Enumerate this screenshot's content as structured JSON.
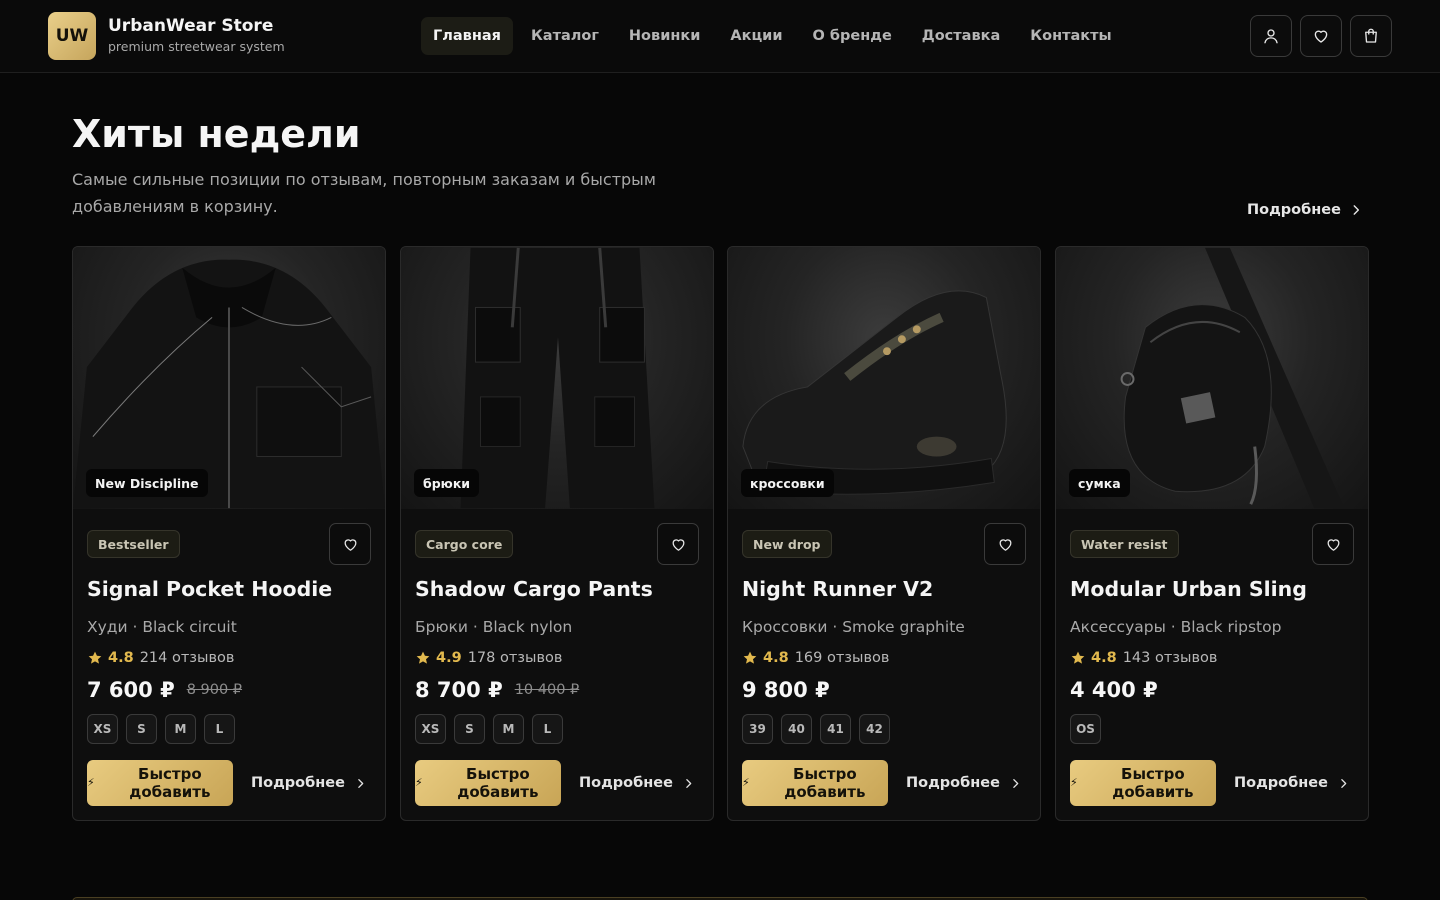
{
  "header": {
    "logo": "UW",
    "brand_name": "UrbanWear Store",
    "brand_sub": "premium streetwear system",
    "nav": [
      "Главная",
      "Каталог",
      "Новинки",
      "Акции",
      "О бренде",
      "Доставка",
      "Контакты"
    ],
    "active_nav": "Главная",
    "icons": [
      "user-icon",
      "heart-icon",
      "cart-icon"
    ]
  },
  "section": {
    "title": "Хиты недели",
    "description": "Самые сильные позиции по отзывам, повторным заказам и быстрым добавлениям в корзину.",
    "more": "Подробнее"
  },
  "colors": {
    "background": "#070707",
    "accent_gold": "#d9bb6c",
    "rating_gold": "#e2b94e"
  },
  "products": [
    {
      "image_tag": "New Discipline",
      "badge": "Bestseller",
      "name": "Signal Pocket Hoodie",
      "meta": "Худи · Black circuit",
      "rating": "4.8",
      "reviews": "214 отзывов",
      "price": "7 600 ₽",
      "old_price": "8 900 ₽",
      "sizes": [
        "XS",
        "S",
        "M",
        "L"
      ],
      "quick_add": "Быстро добавить",
      "more": "Подробнее",
      "image": "hoodie"
    },
    {
      "image_tag": "брюки",
      "badge": "Cargo core",
      "name": "Shadow Cargo Pants",
      "meta": "Брюки · Black nylon",
      "rating": "4.9",
      "reviews": "178 отзывов",
      "price": "8 700 ₽",
      "old_price": "10 400 ₽",
      "sizes": [
        "XS",
        "S",
        "M",
        "L"
      ],
      "quick_add": "Быстро добавить",
      "more": "Подробнее",
      "image": "cargo-pants"
    },
    {
      "image_tag": "кроссовки",
      "badge": "New drop",
      "name": "Night Runner V2",
      "meta": "Кроссовки · Smoke graphite",
      "rating": "4.8",
      "reviews": "169 отзывов",
      "price": "9 800 ₽",
      "old_price": "",
      "sizes": [
        "39",
        "40",
        "41",
        "42"
      ],
      "quick_add": "Быстро добавить",
      "more": "Подробнее",
      "image": "sneaker"
    },
    {
      "image_tag": "сумка",
      "badge": "Water resist",
      "name": "Modular Urban Sling",
      "meta": "Аксессуары · Black ripstop",
      "rating": "4.8",
      "reviews": "143 отзывов",
      "price": "4 400 ₽",
      "old_price": "",
      "sizes": [
        "OS"
      ],
      "quick_add": "Быстро добавить",
      "more": "Подробнее",
      "image": "sling-bag"
    }
  ]
}
